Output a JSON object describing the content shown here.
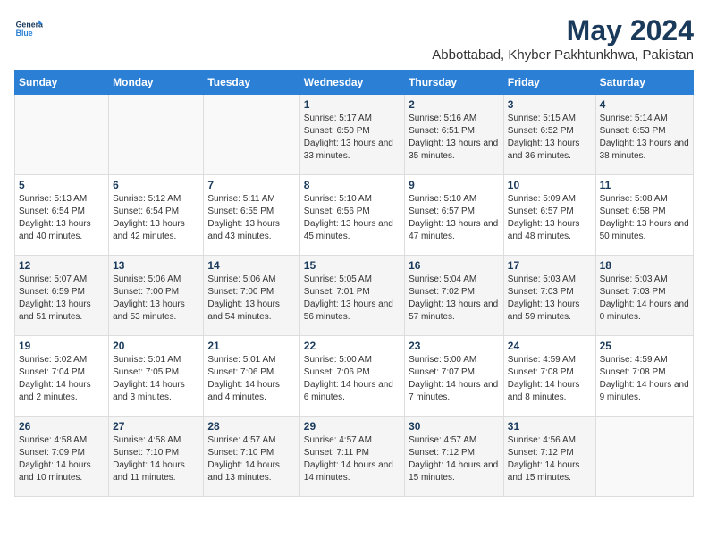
{
  "logo": {
    "line1": "General",
    "line2": "Blue"
  },
  "title": "May 2024",
  "subtitle": "Abbottabad, Khyber Pakhtunkhwa, Pakistan",
  "days_of_week": [
    "Sunday",
    "Monday",
    "Tuesday",
    "Wednesday",
    "Thursday",
    "Friday",
    "Saturday"
  ],
  "weeks": [
    [
      {
        "day": "",
        "info": ""
      },
      {
        "day": "",
        "info": ""
      },
      {
        "day": "",
        "info": ""
      },
      {
        "day": "1",
        "info": "Sunrise: 5:17 AM\nSunset: 6:50 PM\nDaylight: 13 hours and 33 minutes."
      },
      {
        "day": "2",
        "info": "Sunrise: 5:16 AM\nSunset: 6:51 PM\nDaylight: 13 hours and 35 minutes."
      },
      {
        "day": "3",
        "info": "Sunrise: 5:15 AM\nSunset: 6:52 PM\nDaylight: 13 hours and 36 minutes."
      },
      {
        "day": "4",
        "info": "Sunrise: 5:14 AM\nSunset: 6:53 PM\nDaylight: 13 hours and 38 minutes."
      }
    ],
    [
      {
        "day": "5",
        "info": "Sunrise: 5:13 AM\nSunset: 6:54 PM\nDaylight: 13 hours and 40 minutes."
      },
      {
        "day": "6",
        "info": "Sunrise: 5:12 AM\nSunset: 6:54 PM\nDaylight: 13 hours and 42 minutes."
      },
      {
        "day": "7",
        "info": "Sunrise: 5:11 AM\nSunset: 6:55 PM\nDaylight: 13 hours and 43 minutes."
      },
      {
        "day": "8",
        "info": "Sunrise: 5:10 AM\nSunset: 6:56 PM\nDaylight: 13 hours and 45 minutes."
      },
      {
        "day": "9",
        "info": "Sunrise: 5:10 AM\nSunset: 6:57 PM\nDaylight: 13 hours and 47 minutes."
      },
      {
        "day": "10",
        "info": "Sunrise: 5:09 AM\nSunset: 6:57 PM\nDaylight: 13 hours and 48 minutes."
      },
      {
        "day": "11",
        "info": "Sunrise: 5:08 AM\nSunset: 6:58 PM\nDaylight: 13 hours and 50 minutes."
      }
    ],
    [
      {
        "day": "12",
        "info": "Sunrise: 5:07 AM\nSunset: 6:59 PM\nDaylight: 13 hours and 51 minutes."
      },
      {
        "day": "13",
        "info": "Sunrise: 5:06 AM\nSunset: 7:00 PM\nDaylight: 13 hours and 53 minutes."
      },
      {
        "day": "14",
        "info": "Sunrise: 5:06 AM\nSunset: 7:00 PM\nDaylight: 13 hours and 54 minutes."
      },
      {
        "day": "15",
        "info": "Sunrise: 5:05 AM\nSunset: 7:01 PM\nDaylight: 13 hours and 56 minutes."
      },
      {
        "day": "16",
        "info": "Sunrise: 5:04 AM\nSunset: 7:02 PM\nDaylight: 13 hours and 57 minutes."
      },
      {
        "day": "17",
        "info": "Sunrise: 5:03 AM\nSunset: 7:03 PM\nDaylight: 13 hours and 59 minutes."
      },
      {
        "day": "18",
        "info": "Sunrise: 5:03 AM\nSunset: 7:03 PM\nDaylight: 14 hours and 0 minutes."
      }
    ],
    [
      {
        "day": "19",
        "info": "Sunrise: 5:02 AM\nSunset: 7:04 PM\nDaylight: 14 hours and 2 minutes."
      },
      {
        "day": "20",
        "info": "Sunrise: 5:01 AM\nSunset: 7:05 PM\nDaylight: 14 hours and 3 minutes."
      },
      {
        "day": "21",
        "info": "Sunrise: 5:01 AM\nSunset: 7:06 PM\nDaylight: 14 hours and 4 minutes."
      },
      {
        "day": "22",
        "info": "Sunrise: 5:00 AM\nSunset: 7:06 PM\nDaylight: 14 hours and 6 minutes."
      },
      {
        "day": "23",
        "info": "Sunrise: 5:00 AM\nSunset: 7:07 PM\nDaylight: 14 hours and 7 minutes."
      },
      {
        "day": "24",
        "info": "Sunrise: 4:59 AM\nSunset: 7:08 PM\nDaylight: 14 hours and 8 minutes."
      },
      {
        "day": "25",
        "info": "Sunrise: 4:59 AM\nSunset: 7:08 PM\nDaylight: 14 hours and 9 minutes."
      }
    ],
    [
      {
        "day": "26",
        "info": "Sunrise: 4:58 AM\nSunset: 7:09 PM\nDaylight: 14 hours and 10 minutes."
      },
      {
        "day": "27",
        "info": "Sunrise: 4:58 AM\nSunset: 7:10 PM\nDaylight: 14 hours and 11 minutes."
      },
      {
        "day": "28",
        "info": "Sunrise: 4:57 AM\nSunset: 7:10 PM\nDaylight: 14 hours and 13 minutes."
      },
      {
        "day": "29",
        "info": "Sunrise: 4:57 AM\nSunset: 7:11 PM\nDaylight: 14 hours and 14 minutes."
      },
      {
        "day": "30",
        "info": "Sunrise: 4:57 AM\nSunset: 7:12 PM\nDaylight: 14 hours and 15 minutes."
      },
      {
        "day": "31",
        "info": "Sunrise: 4:56 AM\nSunset: 7:12 PM\nDaylight: 14 hours and 15 minutes."
      },
      {
        "day": "",
        "info": ""
      }
    ]
  ]
}
